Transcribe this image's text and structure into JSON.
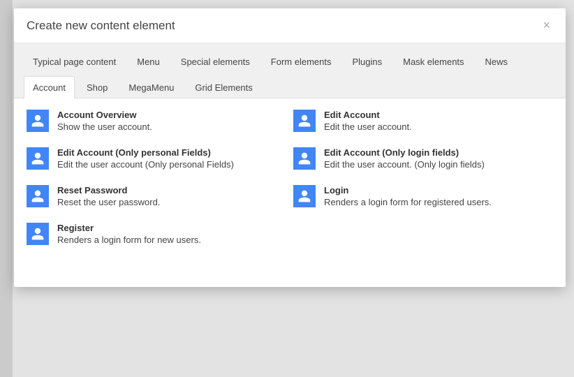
{
  "modal": {
    "title": "Create new content element",
    "close_label": "×"
  },
  "tabs": {
    "row1": [
      "Typical page content",
      "Menu",
      "Special elements",
      "Form elements",
      "Plugins",
      "Mask elements",
      "News"
    ],
    "row2": [
      "Account",
      "Shop",
      "MegaMenu",
      "Grid Elements"
    ],
    "active": "Account"
  },
  "elements": [
    {
      "title": "Account Overview",
      "desc": "Show the user account."
    },
    {
      "title": "Edit Account",
      "desc": "Edit the user account."
    },
    {
      "title": "Edit Account (Only personal Fields)",
      "desc": "Edit the user account (Only personal Fields)"
    },
    {
      "title": "Edit Account (Only login fields)",
      "desc": "Edit the user account. (Only login fields)"
    },
    {
      "title": "Reset Password",
      "desc": "Reset the user password."
    },
    {
      "title": "Login",
      "desc": "Renders a login form for registered users."
    },
    {
      "title": "Register",
      "desc": "Renders a login form for new users."
    }
  ]
}
